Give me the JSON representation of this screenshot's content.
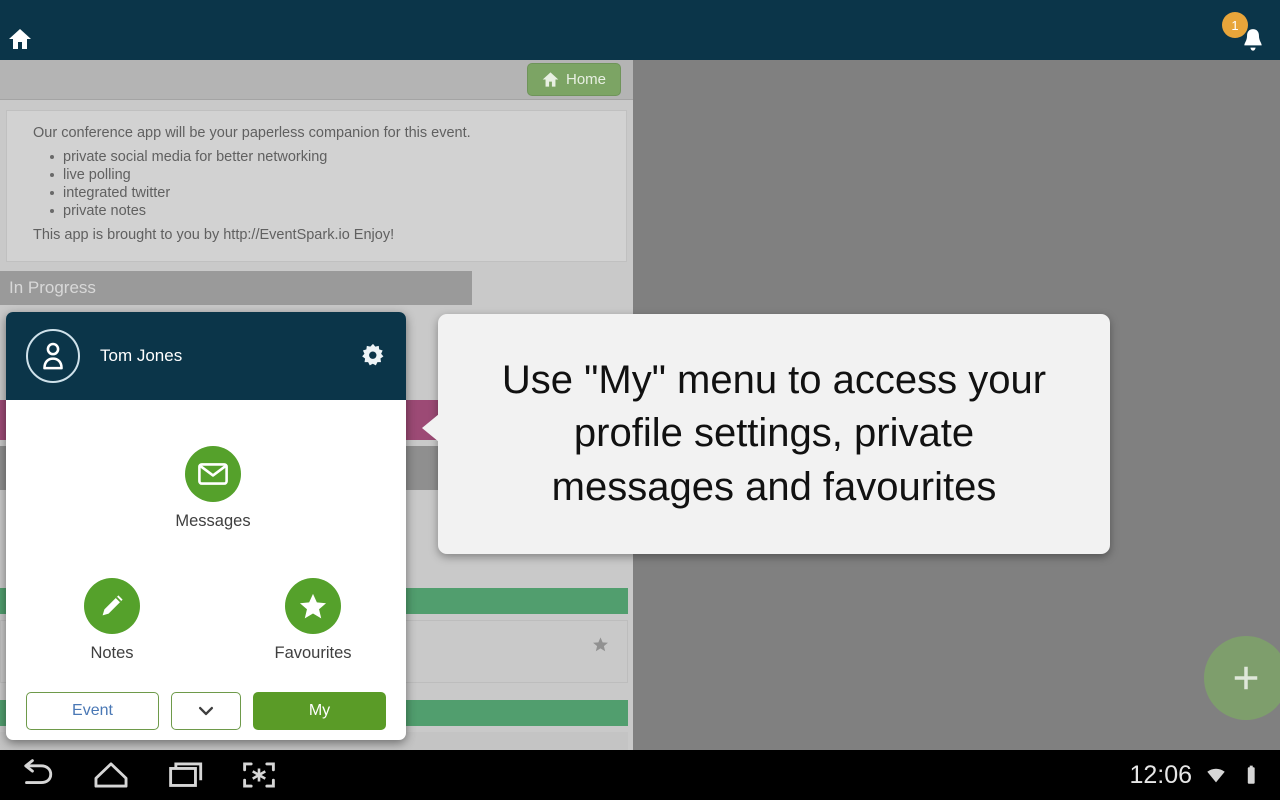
{
  "appbar": {
    "home_icon": "home-icon",
    "notification": {
      "badge_count": "1",
      "bell_icon": "bell-icon"
    }
  },
  "toolbar": {
    "home_button_label": "Home",
    "home_button_icon": "home-icon"
  },
  "info_card": {
    "intro": "Our conference app will be your paperless companion for this event.",
    "bullets": [
      "private social media for better networking",
      "live polling",
      "integrated twitter",
      "private notes"
    ],
    "footer": "This app is brought to you by http://EventSpark.io Enjoy!"
  },
  "section": {
    "in_progress_label": "In Progress"
  },
  "background_rows": {
    "star_icon": "star-icon"
  },
  "fab": {
    "icon": "plus-icon"
  },
  "my_panel": {
    "profile_name": "Tom Jones",
    "avatar_icon": "person-icon",
    "settings_icon": "gear-icon",
    "items": [
      {
        "label": "Messages",
        "icon": "envelope-icon"
      },
      {
        "label": "Notes",
        "icon": "pencil-icon"
      },
      {
        "label": "Favourites",
        "icon": "star-icon"
      }
    ],
    "footer": {
      "event_label": "Event",
      "chevron_icon": "chevron-down-icon",
      "my_label": "My"
    }
  },
  "tooltip": {
    "text": "Use \"My\" menu to access your profile settings, private messages and favourites"
  },
  "navbar": {
    "back_icon": "back-icon",
    "home_icon": "home-icon",
    "recents_icon": "recents-icon",
    "screenshot_icon": "screenshot-icon",
    "clock": "12:06",
    "wifi_icon": "wifi-icon",
    "battery_icon": "battery-icon"
  },
  "colors": {
    "appbar": "#0b3549",
    "accent_green": "#55a12b",
    "button_green": "#5a9b27",
    "row_green": "#519e6e",
    "row_magenta": "#9c4a75",
    "badge_orange": "#e8a53a",
    "link_blue": "#4a78b5"
  }
}
